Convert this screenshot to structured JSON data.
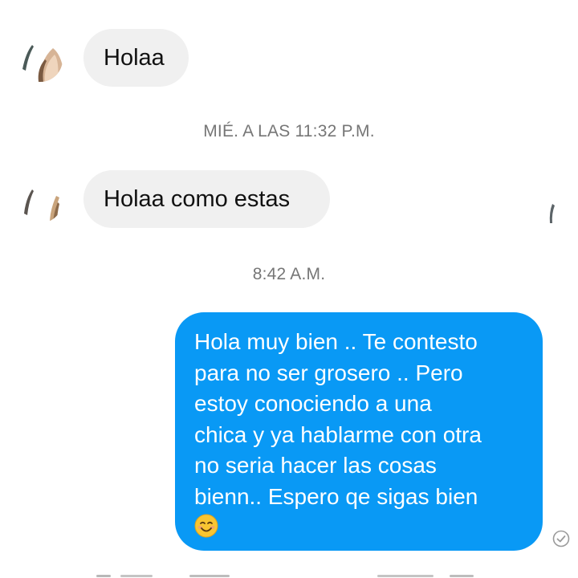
{
  "conversation": {
    "messages": [
      {
        "direction": "incoming",
        "text": "Holaa"
      },
      {
        "direction": "incoming",
        "text": "Holaa como estas"
      }
    ],
    "timestamps": [
      "MIÉ. A LAS 11:32 P.M.",
      "8:42 A.M."
    ],
    "outgoing": {
      "lines": [
        "Hola muy bien .. Te contesto",
        "para no ser grosero .. Pero",
        "estoy conociendo a una",
        "chica y ya hablarme con otra",
        "no seria hacer las cosas",
        "bienn.. Espero qe sigas bien"
      ],
      "emoji": "smiling-face-emoji",
      "status_icon": "seen-check-icon"
    }
  },
  "colors": {
    "outgoing_bubble": "#0999f5",
    "incoming_bubble": "#f0f0f0",
    "timestamp_text": "#767676",
    "emoji_face": "#f9c531"
  }
}
